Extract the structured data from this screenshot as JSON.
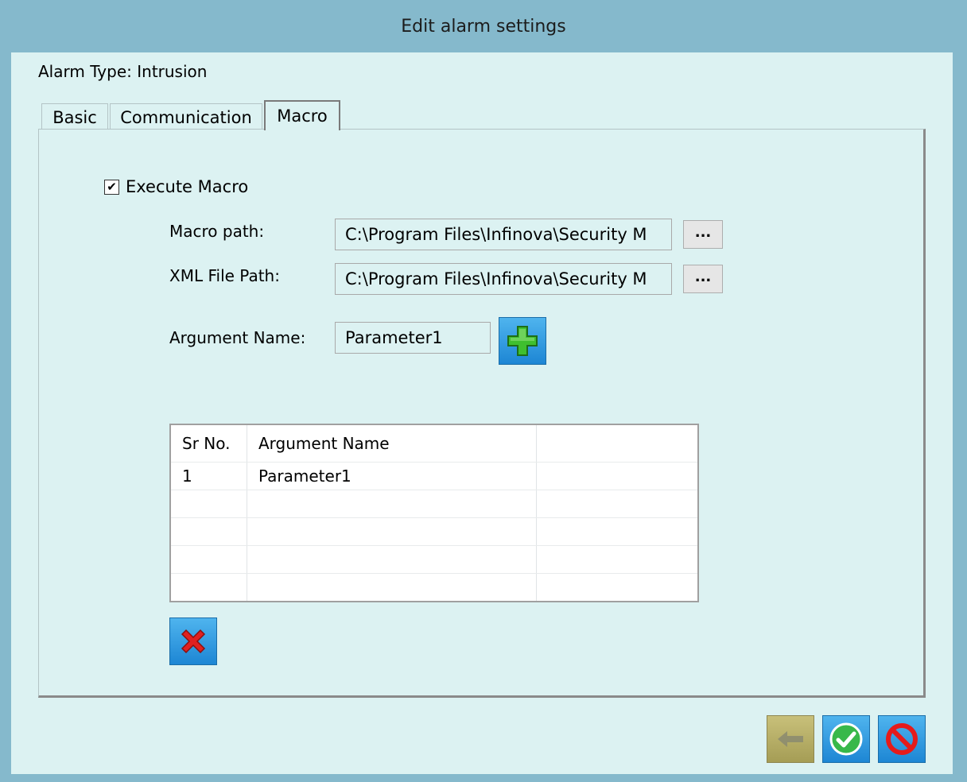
{
  "window": {
    "title": "Edit alarm settings"
  },
  "alarm_type": "Alarm Type: Intrusion",
  "tabs": [
    {
      "label": "Basic",
      "active": false
    },
    {
      "label": "Communication",
      "active": false
    },
    {
      "label": "Macro",
      "active": true
    }
  ],
  "macro": {
    "execute_label": "Execute Macro",
    "execute_checked": true,
    "macro_path_label": "Macro path:",
    "macro_path_value": "C:\\Program Files\\Infinova\\Security M",
    "xml_path_label": "XML File Path:",
    "xml_path_value": "C:\\Program Files\\Infinova\\Security M",
    "browse_label": "...",
    "argument_label": "Argument Name:",
    "argument_value": "Parameter1",
    "add_icon": "plus-icon",
    "delete_icon": "x-icon"
  },
  "table": {
    "headers": [
      "Sr No.",
      "Argument Name",
      ""
    ],
    "rows": [
      [
        "1",
        "Parameter1",
        ""
      ],
      [
        "",
        "",
        ""
      ],
      [
        "",
        "",
        ""
      ],
      [
        "",
        "",
        ""
      ],
      [
        "",
        "",
        ""
      ]
    ]
  },
  "footer": {
    "back_icon": "back-arrow-icon",
    "ok_icon": "checkmark-icon",
    "cancel_icon": "no-entry-icon"
  },
  "colors": {
    "titlebar": "#85b9cc",
    "client": "#dcf2f2",
    "button_blue": "#1d86d4",
    "add_green": "#3fbf2f",
    "delete_red": "#e02020",
    "ok_green": "#38b84a",
    "cancel_red": "#e51b1b"
  }
}
